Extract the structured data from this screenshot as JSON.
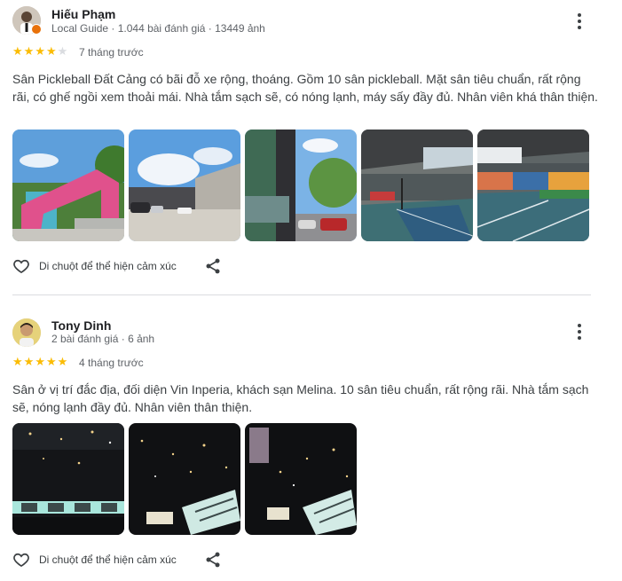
{
  "reviews": [
    {
      "name": "Hiếu Phạm",
      "meta": "Local Guide · 1.044 bài đánh giá · 13449 ảnh",
      "rating": 4,
      "rating_max": 5,
      "time": "7 tháng trước",
      "text": "Sân Pickleball Đất Cảng có bãi đỗ xe rộng, thoáng. Gồm 10 sân pickleball. Mặt sân tiêu chuẩn, rất rộng rãi, có ghế ngồi xem thoải mái. Nhà tắm sạch sẽ, có nóng lạnh, máy sấy đầy đủ. Nhân viên khá thân thiện.",
      "photos": [
        "entrance-gate",
        "parking-lot",
        "side-building",
        "indoor-courts",
        "court-mural"
      ],
      "react_label": "Di chuột để thể hiện cảm xúc",
      "local_guide_badge": true
    },
    {
      "name": "Tony Dinh",
      "meta": "2 bài đánh giá · 6 ảnh",
      "rating": 5,
      "rating_max": 5,
      "time": "4 tháng trước",
      "text": "Sân ở vị trí đắc địa, đối diện Vin Inperia, khách sạn Melina. 10 sân tiêu chuẩn, rất rộng rãi. Nhà tắm sạch sẽ, nóng lạnh đầy đủ. Nhân viên thân thiện.",
      "photos": [
        "night-city-1",
        "night-city-2",
        "night-city-3"
      ],
      "react_label": "Di chuột để thể hiện cảm xúc",
      "local_guide_badge": false
    }
  ],
  "icons": {
    "menu": "more-vert-icon",
    "react": "heart-outline-icon",
    "share": "share-icon",
    "star": "star-icon"
  },
  "colors": {
    "star_on": "#fbbc04",
    "star_off": "#dadce0",
    "badge": "#e8710a",
    "divider": "#dadce0"
  }
}
